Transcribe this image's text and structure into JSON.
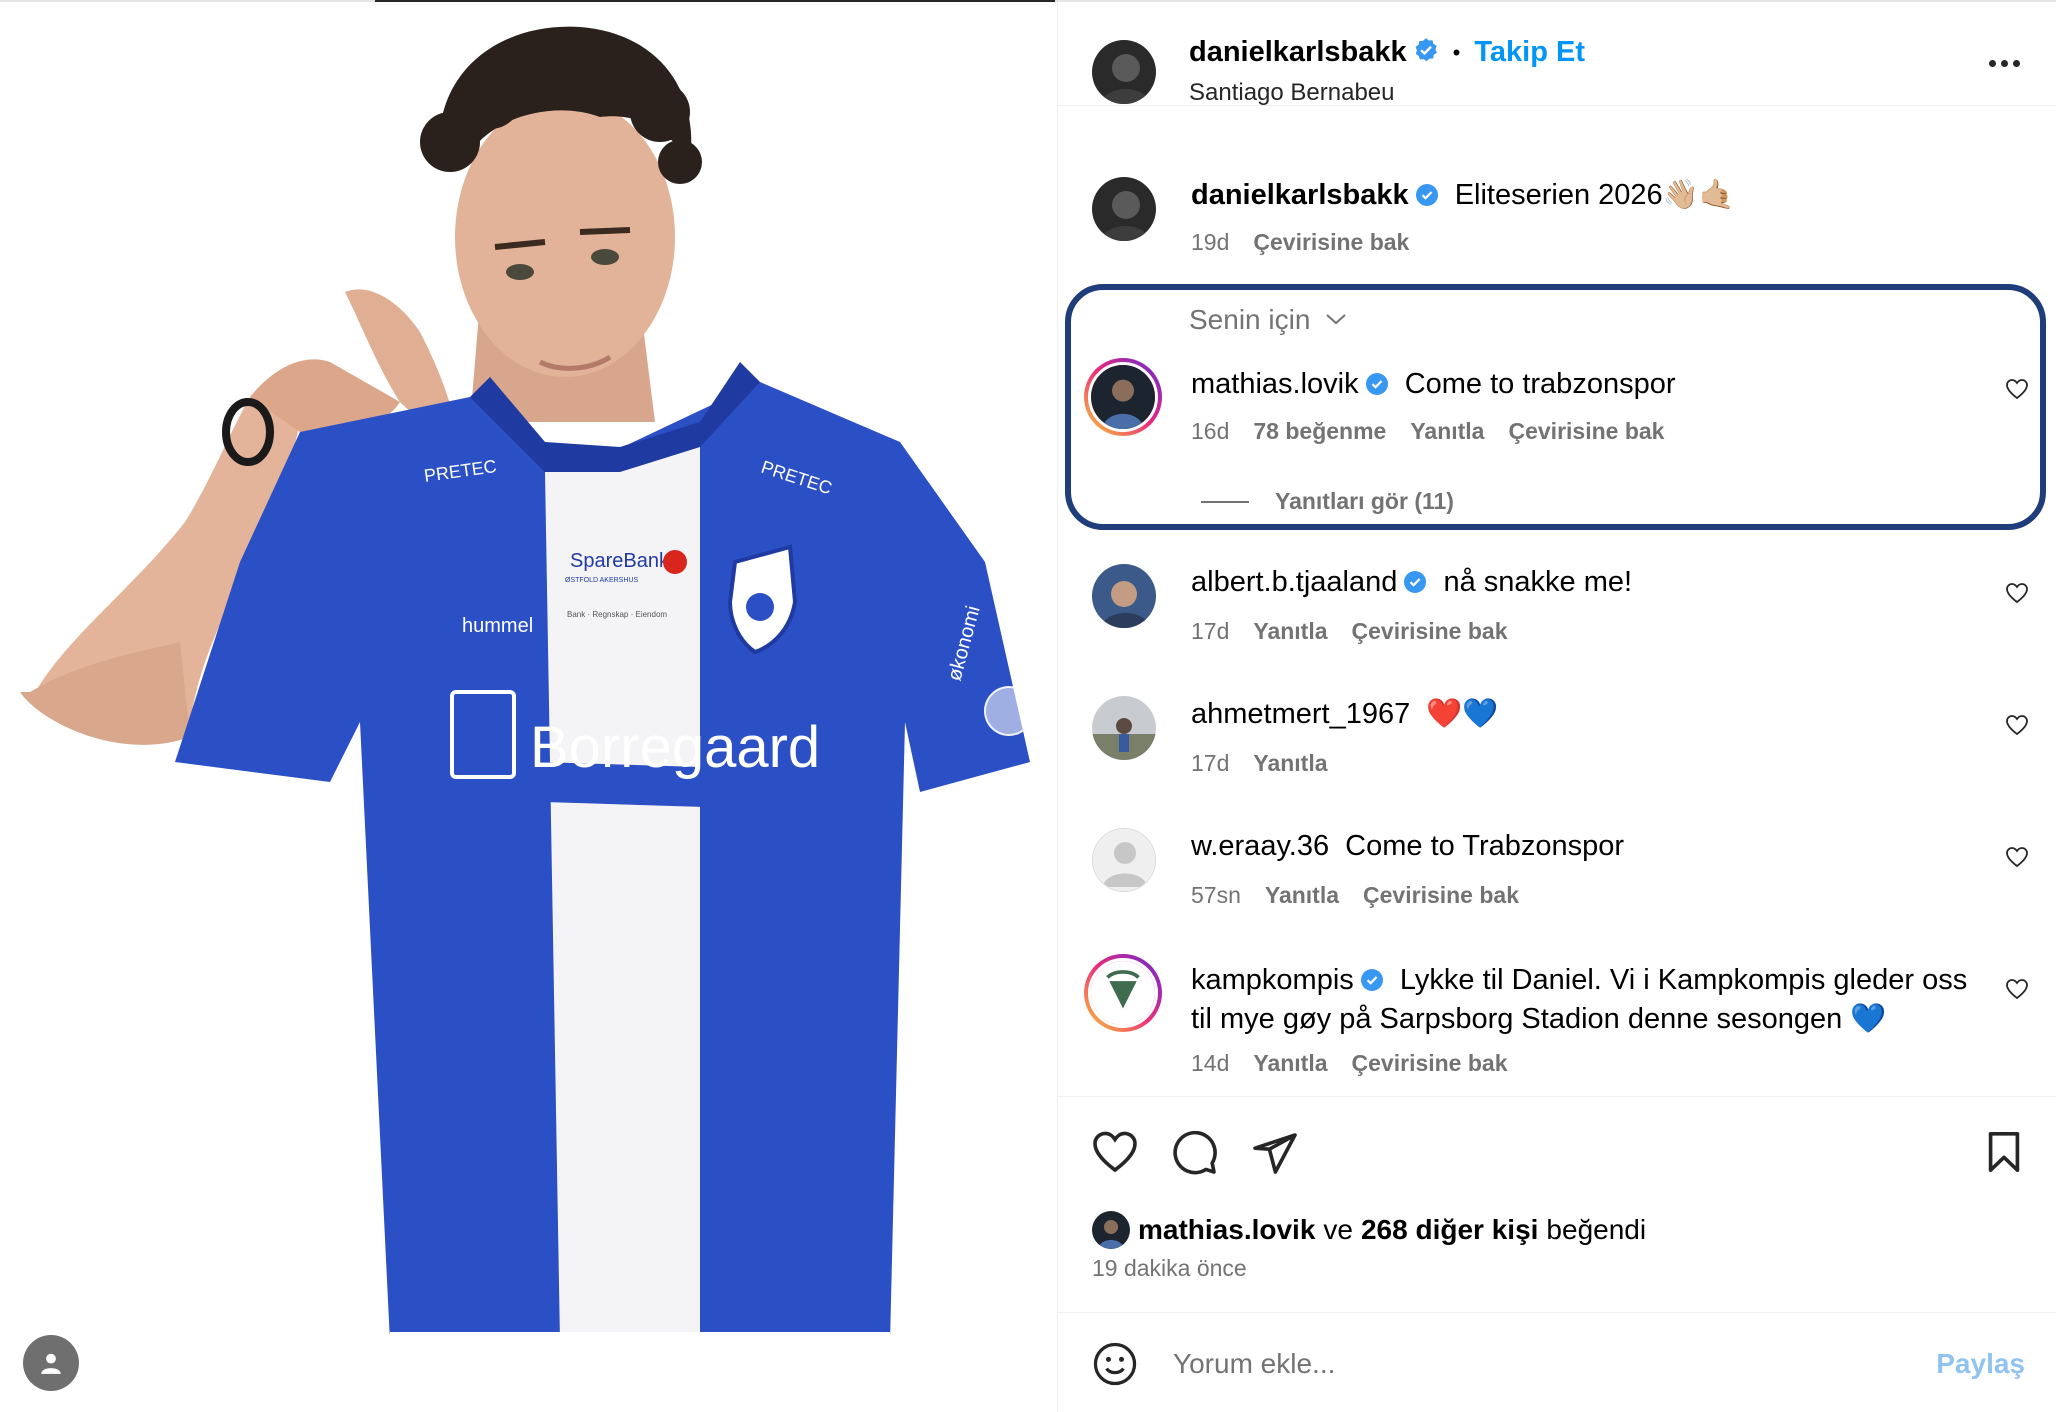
{
  "post": {
    "author": "danielkarlsbakk",
    "follow_label": "Takip Et",
    "separator": "•",
    "location": "Santiago Bernabeu",
    "caption_text": "Eliteserien 2026👋🏼🤙🏼",
    "caption_age": "19d",
    "caption_translate": "Çevirisine bak"
  },
  "filter": {
    "label": "Senin için"
  },
  "comments": [
    {
      "user": "mathias.lovik",
      "verified": true,
      "text": "Come to trabzonspor",
      "age": "16d",
      "likes": "78 beğenme",
      "reply": "Yanıtla",
      "translate": "Çevirisine bak",
      "view_replies": "Yanıtları gör (11)"
    },
    {
      "user": "albert.b.tjaaland",
      "verified": true,
      "text": "nå snakke me!",
      "age": "17d",
      "reply": "Yanıtla",
      "translate": "Çevirisine bak"
    },
    {
      "user": "ahmetmert_1967",
      "verified": false,
      "text": "❤️💙",
      "age": "17d",
      "reply": "Yanıtla"
    },
    {
      "user": "w.eraay.36",
      "verified": false,
      "text": "Come to Trabzonspor",
      "age": "57sn",
      "reply": "Yanıtla",
      "translate": "Çevirisine bak"
    },
    {
      "user": "kampkompis",
      "verified": true,
      "text_line1": "Lykke til Daniel. Vi i Kampkompis gleder oss",
      "text_line2": "til mye gøy på Sarpsborg Stadion denne sesongen 💙",
      "age": "14d",
      "reply": "Yanıtla",
      "translate": "Çevirisine bak"
    }
  ],
  "likes": {
    "user": "mathias.lovik",
    "connector": "ve",
    "others": "268 diğer kişi",
    "suffix": "beğendi"
  },
  "posted_time": "19 dakika önce",
  "composer": {
    "placeholder": "Yorum ekle...",
    "share_label": "Paylaş"
  },
  "jersey": {
    "sponsor": "Borregaard",
    "bank": "SpareBank",
    "bank_region": "ØSTFOLD AKERSHUS",
    "bank_small": "Bank · Regnskap · Eiendom",
    "kit_brand": "hummel",
    "collar_sponsor": "PRETEC",
    "sleeve_text": "økonomi"
  },
  "colors": {
    "accent": "#0095f6",
    "highlight": "#1f3d7a",
    "jersey_blue": "#2b4fc4",
    "muted": "#737373"
  }
}
